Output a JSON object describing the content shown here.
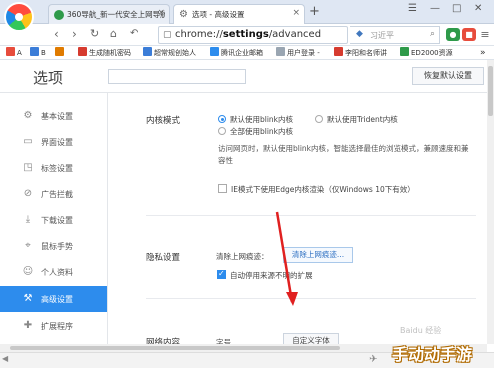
{
  "tabs": [
    {
      "title": "360导航_新一代安全上网导航"
    },
    {
      "title": "选项 - 高级设置"
    }
  ],
  "toolbar": {
    "url_prefix": "chrome://",
    "url_path": "settings",
    "url_rest": "/advanced",
    "search_placeholder": "习近平"
  },
  "bookmarks": [
    {
      "label": "A",
      "color": "#e74c3c"
    },
    {
      "label": "B",
      "color": "#3b7dd8"
    },
    {
      "label": "生成随机密码",
      "color": "#d63b2f"
    },
    {
      "label": "超常规创始人",
      "color": "#3b7dd8"
    },
    {
      "label": "腾讯企业邮箱",
      "color": "#2d8ced"
    },
    {
      "label": "用户登录 -",
      "color": "#9aa6b2"
    },
    {
      "label": "李阳和名师讲",
      "color": "#d63b2f"
    },
    {
      "label": "ED2000资源",
      "color": "#2e9a4a"
    }
  ],
  "page": {
    "title": "选项",
    "reset_button": "恢复默认设置"
  },
  "sidebar": {
    "items": [
      {
        "label": "基本设置",
        "icon": "gear-icon",
        "glyph": "⚙"
      },
      {
        "label": "界面设置",
        "icon": "window-icon",
        "glyph": "▭"
      },
      {
        "label": "标签设置",
        "icon": "tag-icon",
        "glyph": "◳"
      },
      {
        "label": "广告拦截",
        "icon": "shield-icon",
        "glyph": "⊘"
      },
      {
        "label": "下载设置",
        "icon": "download-icon",
        "glyph": "⤓"
      },
      {
        "label": "鼠标手势",
        "icon": "mouse-icon",
        "glyph": "⌖"
      },
      {
        "label": "个人资料",
        "icon": "user-icon",
        "glyph": "☺"
      },
      {
        "label": "高级设置",
        "icon": "wrench-icon",
        "glyph": "⚒",
        "active": true
      },
      {
        "label": "扩展程序",
        "icon": "puzzle-icon",
        "glyph": "✚"
      }
    ]
  },
  "kernel": {
    "title": "内核模式",
    "opt1": "默认使用blink内核",
    "opt2": "默认使用Trident内核",
    "opt3": "全部使用blink内核",
    "desc_line1": "访问网页时，默认使用blink内核，智能选择最佳的浏览模式，兼顾速度和兼",
    "desc_line2": "容性",
    "ie_edge": "IE模式下使用Edge内核渲染（仅Windows 10下有效）"
  },
  "privacy": {
    "title": "隐私设置",
    "clear_label": "清除上网痕迹：",
    "clear_button": "清除上网痕迹...",
    "auto_disable": "自动停用来源不明的扩展"
  },
  "next_section": {
    "title": "网络内容",
    "field": "字号",
    "button": "自定义字体"
  },
  "watermark": {
    "main": "手动动手游",
    "small": "Baidu 经验"
  },
  "colors": {
    "accent": "#2d8ced",
    "annotation_arrow": "#e02020"
  }
}
